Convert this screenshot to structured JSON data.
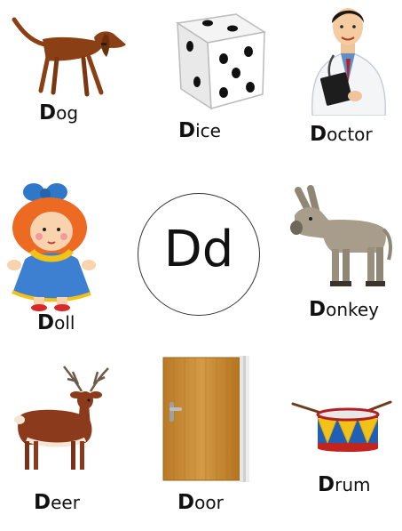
{
  "center_letter": "Dd",
  "cards": [
    {
      "label": "Dog"
    },
    {
      "label": "Dice"
    },
    {
      "label": "Doctor"
    },
    {
      "label": "Doll"
    },
    {
      "label": "Donkey"
    },
    {
      "label": "Deer"
    },
    {
      "label": "Door"
    },
    {
      "label": "Drum"
    }
  ],
  "colors": {
    "dog": "#8a3f14",
    "dice": "#ffffff",
    "door": "#c8892f",
    "drum": "#1f5fb5",
    "drum_triangles": "#f2c218",
    "donkey": "#a89d8a",
    "deer": "#8b3a1c",
    "doll_hair": "#ee6a23",
    "doll_dress": "#3d7fd0"
  }
}
